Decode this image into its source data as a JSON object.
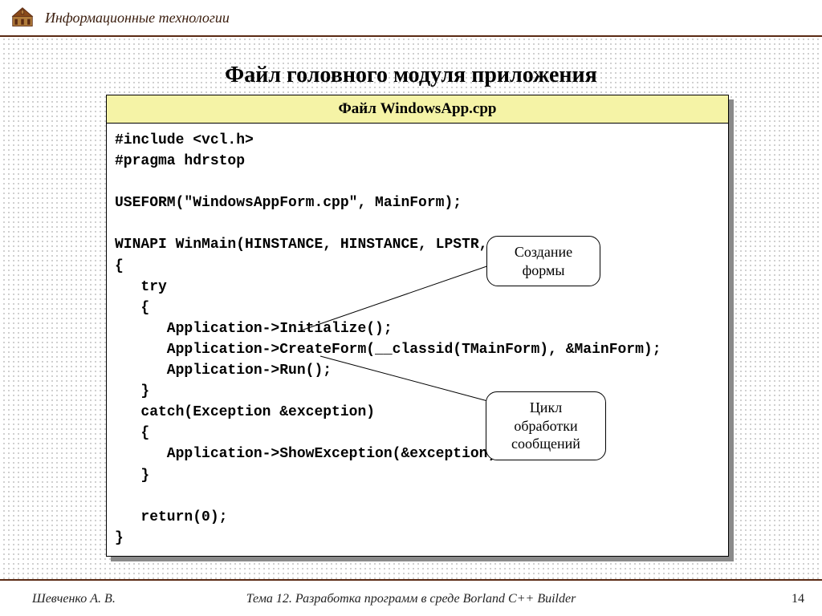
{
  "header": {
    "course": "Информационные технологии"
  },
  "slide": {
    "title": "Файл головного модуля приложения",
    "panel_title": "Файл WindowsApp.cpp",
    "code": "#include <vcl.h>\n#pragma hdrstop\n\nUSEFORM(\"WindowsAppForm.cpp\", MainForm);\n\nWINAPI WinMain(HINSTANCE, HINSTANCE, LPSTR, int)\n{\n   try\n   {\n      Application->Initialize();\n      Application->CreateForm(__classid(TMainForm), &MainForm);\n      Application->Run();\n   }\n   catch(Exception &exception)\n   {\n      Application->ShowException(&exception);\n   }\n\n   return(0);\n}"
  },
  "callouts": {
    "create_form": "Создание\nформы",
    "msg_loop": "Цикл\nобработки\nсообщений"
  },
  "footer": {
    "author": "Шевченко А. В.",
    "topic": "Тема 12. Разработка программ в среде Borland C++ Builder",
    "page": "14"
  }
}
